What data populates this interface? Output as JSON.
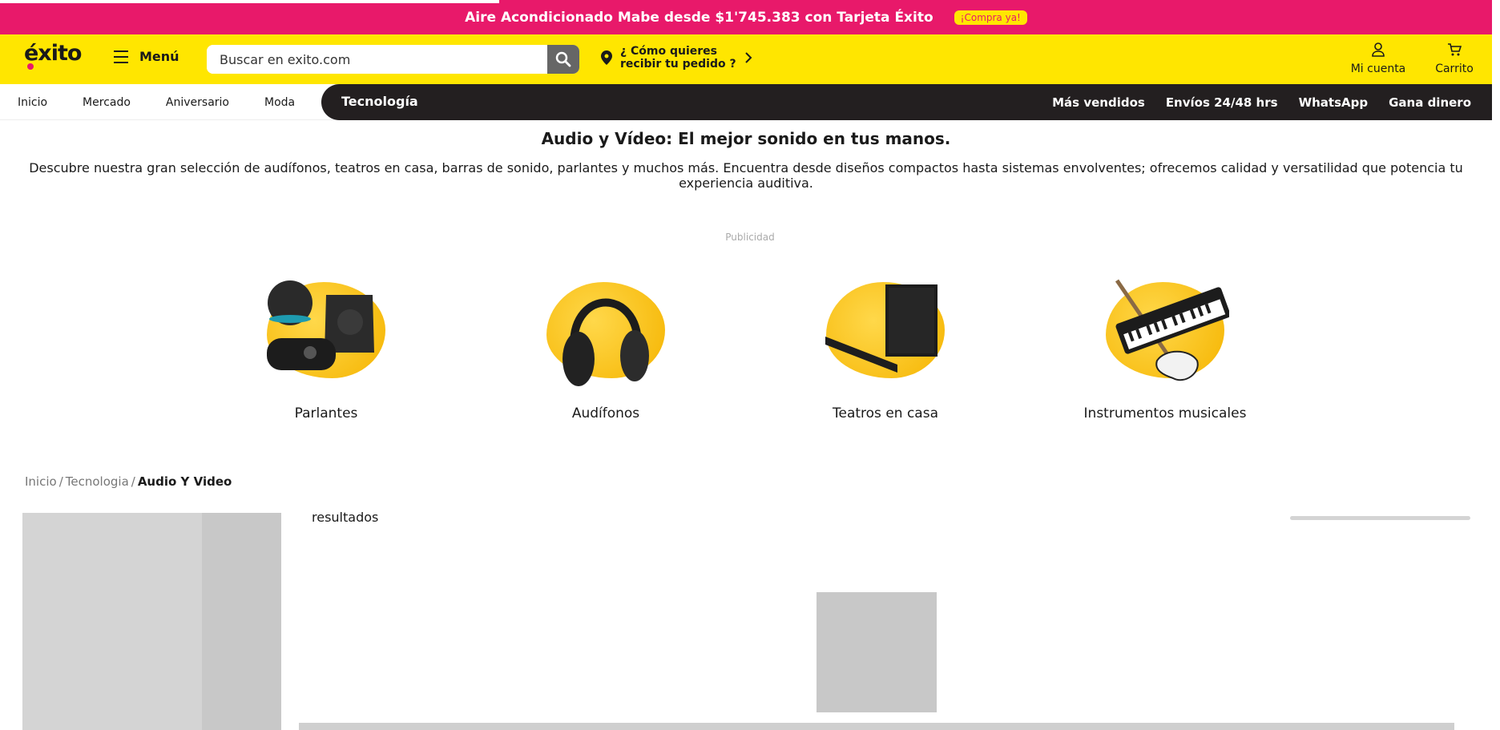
{
  "promo": {
    "text": "Aire Acondicionado Mabe desde $1'745.383 con Tarjeta Éxito",
    "cta": "¡Compra ya!"
  },
  "header": {
    "logo": "éxito",
    "menu_label": "Menú",
    "search_placeholder": "Buscar en exito.com",
    "delivery_line1": "¿ Cómo quieres",
    "delivery_line2": "recibir tu pedido ?",
    "account_label": "Mi cuenta",
    "cart_label": "Carrito"
  },
  "nav": {
    "items": [
      "Inicio",
      "Mercado",
      "Aniversario",
      "Moda"
    ],
    "active": "Tecnología",
    "right_items": [
      "Más vendidos",
      "Envíos 24/48 hrs",
      "WhatsApp",
      "Gana dinero"
    ]
  },
  "intro": {
    "title": "Audio y Vídeo: El mejor sonido en tus manos.",
    "description": "Descubre nuestra gran selección de audífonos, teatros en casa, barras de sonido, parlantes y muchos más. Encuentra desde diseños compactos hasta sistemas envolventes; ofrecemos calidad y versatilidad que potencia tu experiencia auditiva."
  },
  "ad_label": "Publicidad",
  "categories": [
    {
      "label": "Parlantes",
      "icon": "speakers-image"
    },
    {
      "label": "Audífonos",
      "icon": "headphones-image"
    },
    {
      "label": "Teatros en casa",
      "icon": "home-theater-image"
    },
    {
      "label": "Instrumentos musicales",
      "icon": "musical-instruments-image"
    }
  ],
  "breadcrumb": [
    "Inicio",
    "Tecnologia",
    "Audio Y Video"
  ],
  "results_label": "resultados",
  "colors": {
    "brand_yellow": "#ffe600",
    "brand_pink": "#e8196a",
    "nav_dark": "#231f20"
  }
}
